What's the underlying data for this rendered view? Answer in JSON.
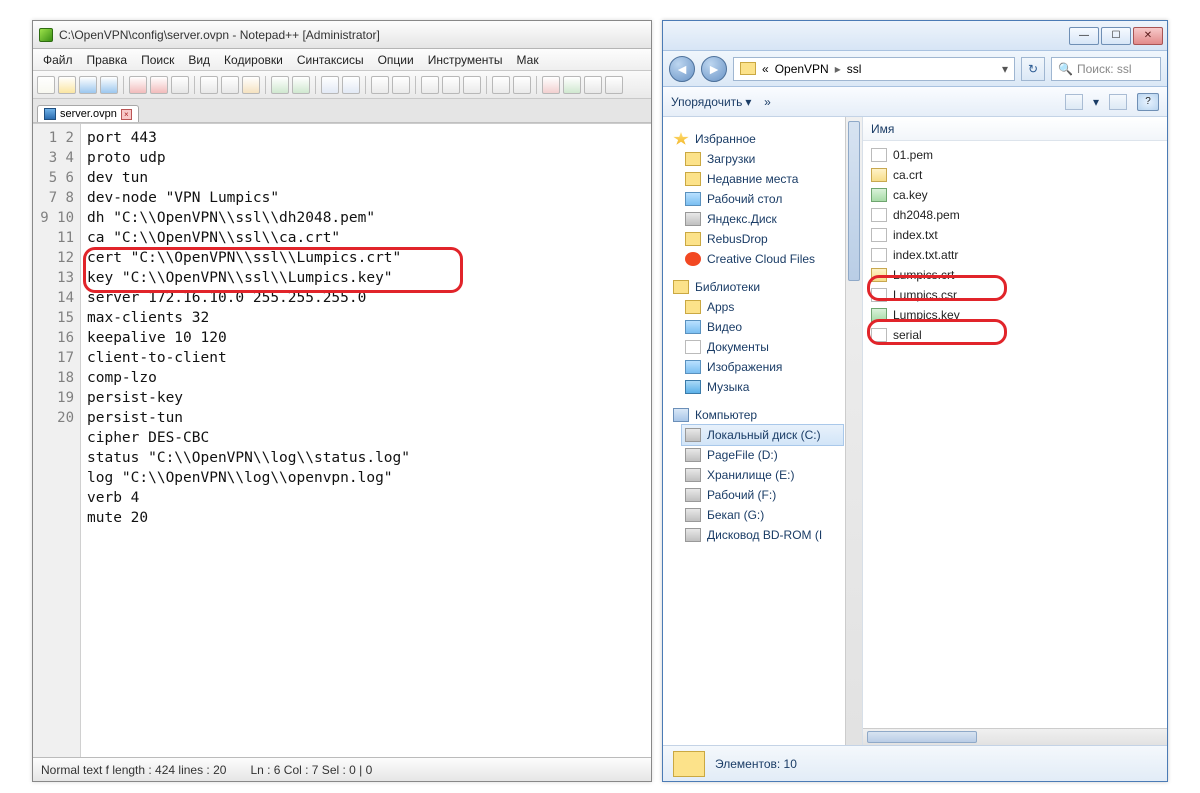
{
  "npp": {
    "title": "C:\\OpenVPN\\config\\server.ovpn - Notepad++ [Administrator]",
    "menu": [
      "Файл",
      "Правка",
      "Поиск",
      "Вид",
      "Кодировки",
      "Синтаксисы",
      "Опции",
      "Инструменты",
      "Мак"
    ],
    "tab": {
      "name": "server.ovpn"
    },
    "linecount": 20,
    "lines": [
      "port 443",
      "proto udp",
      "dev tun",
      "dev-node \"VPN Lumpics\"",
      "dh \"C:\\\\OpenVPN\\\\ssl\\\\dh2048.pem\"",
      "ca \"C:\\\\OpenVPN\\\\ssl\\\\ca.crt\"",
      "cert \"C:\\\\OpenVPN\\\\ssl\\\\Lumpics.crt\"",
      "key \"C:\\\\OpenVPN\\\\ssl\\\\Lumpics.key\"",
      "server 172.16.10.0 255.255.255.0",
      "max-clients 32",
      "keepalive 10 120",
      "client-to-client",
      "comp-lzo",
      "persist-key",
      "persist-tun",
      "cipher DES-CBC",
      "status \"C:\\\\OpenVPN\\\\log\\\\status.log\"",
      "log \"C:\\\\OpenVPN\\\\log\\\\openvpn.log\"",
      "verb 4",
      "mute 20"
    ],
    "status": {
      "left": "Normal text f   length : 424     lines : 20",
      "right": "Ln : 6    Col : 7    Sel : 0 | 0"
    },
    "toolbar_icons": [
      {
        "n": "new",
        "c": "#f8f8f0"
      },
      {
        "n": "open",
        "c": "#fbe6a2"
      },
      {
        "n": "save",
        "c": "#9cc7ef"
      },
      {
        "n": "saveall",
        "c": "#9cc7ef"
      },
      {
        "n": "sep"
      },
      {
        "n": "close",
        "c": "#f2bcbc"
      },
      {
        "n": "closeall",
        "c": "#f2bcbc"
      },
      {
        "n": "print",
        "c": "#e6e6e6"
      },
      {
        "n": "sep"
      },
      {
        "n": "cut",
        "c": "#e8e8e8"
      },
      {
        "n": "copy",
        "c": "#e8e8e8"
      },
      {
        "n": "paste",
        "c": "#f5e2c0"
      },
      {
        "n": "sep"
      },
      {
        "n": "undo",
        "c": "#cfe8cf"
      },
      {
        "n": "redo",
        "c": "#cfe8cf"
      },
      {
        "n": "sep"
      },
      {
        "n": "find",
        "c": "#e2e9f5"
      },
      {
        "n": "replace",
        "c": "#e2e9f5"
      },
      {
        "n": "sep"
      },
      {
        "n": "zoom-in",
        "c": "#eaeaea"
      },
      {
        "n": "zoom-out",
        "c": "#eaeaea"
      },
      {
        "n": "sep"
      },
      {
        "n": "wrap",
        "c": "#eaeaea"
      },
      {
        "n": "showall",
        "c": "#eaeaea"
      },
      {
        "n": "guide",
        "c": "#eaeaea"
      },
      {
        "n": "sep"
      },
      {
        "n": "func",
        "c": "#eaeaea"
      },
      {
        "n": "doc-map",
        "c": "#eaeaea"
      },
      {
        "n": "sep"
      },
      {
        "n": "macro-rec",
        "c": "#f2cfcf"
      },
      {
        "n": "macro-play",
        "c": "#cfe8cf"
      },
      {
        "n": "macro-stop",
        "c": "#e8e8e8"
      },
      {
        "n": "macro-mult",
        "c": "#e8e8e8"
      }
    ]
  },
  "explorer": {
    "breadcrumb": {
      "b1": "OpenVPN",
      "b2": "ssl",
      "prefix": "«"
    },
    "search_placeholder": "Поиск: ssl",
    "organize": "Упорядочить",
    "more": "»",
    "column": "Имя",
    "status_count": "Элементов: 10",
    "tree": {
      "favorites": {
        "head": "Избранное",
        "items": [
          "Загрузки",
          "Недавние места",
          "Рабочий стол",
          "Яндекс.Диск",
          "RebusDrop",
          "Creative Cloud Files"
        ]
      },
      "libraries": {
        "head": "Библиотеки",
        "items": [
          "Apps",
          "Видео",
          "Документы",
          "Изображения",
          "Музыка"
        ]
      },
      "computer": {
        "head": "Компьютер",
        "items": [
          "Локальный диск (C:)",
          "PageFile (D:)",
          "Хранилище (E:)",
          "Рабочий (F:)",
          "Бекап (G:)",
          "Дисковод BD-ROM (I"
        ]
      }
    },
    "files": [
      "01.pem",
      "ca.crt",
      "ca.key",
      "dh2048.pem",
      "index.txt",
      "index.txt.attr",
      "Lumpics.crt",
      "Lumpics.csr",
      "Lumpics.key",
      "serial"
    ],
    "file_icons": [
      "doc",
      "cert",
      "key",
      "doc",
      "doc",
      "doc",
      "cert",
      "doc",
      "key",
      "doc"
    ],
    "highlight_files": [
      6,
      8
    ]
  }
}
